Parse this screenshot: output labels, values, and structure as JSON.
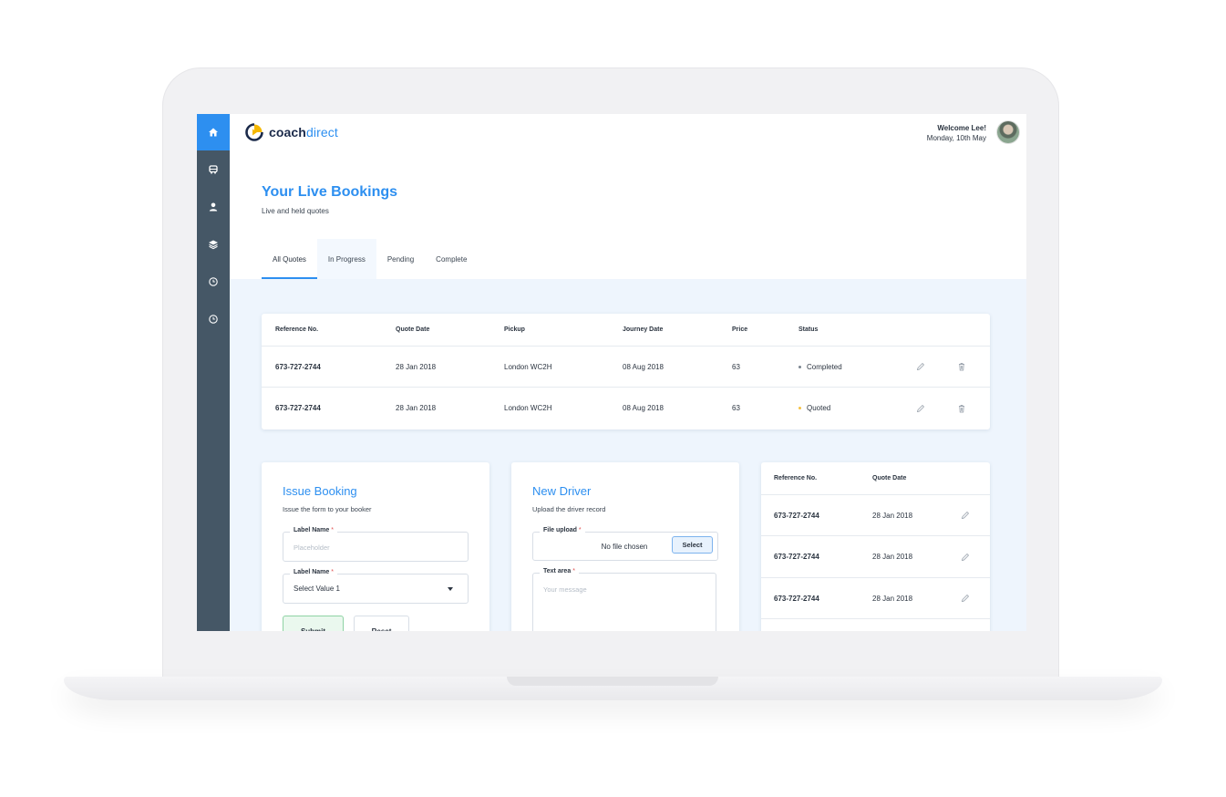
{
  "app": {
    "logo_part1": "coach",
    "logo_part2": "direct",
    "welcome": "Welcome Lee!",
    "date": "Monday, 10th May"
  },
  "sidebar": {
    "items": [
      {
        "icon": "home-icon"
      },
      {
        "icon": "bus-icon"
      },
      {
        "icon": "user-icon"
      },
      {
        "icon": "layers-icon"
      },
      {
        "icon": "clock-icon"
      },
      {
        "icon": "clock-icon"
      }
    ]
  },
  "page": {
    "title": "Your Live Bookings",
    "subtitle": "Live and held quotes"
  },
  "tabs": [
    "All Quotes",
    "In Progress",
    "Pending",
    "Complete"
  ],
  "bookings": {
    "headers": [
      "Reference No.",
      "Quote Date",
      "Pickup",
      "Journey Date",
      "Price",
      "Status"
    ],
    "rows": [
      {
        "ref": "673-727-2744",
        "quote_date": "28 Jan 2018",
        "pickup": "London WC2H",
        "journey_date": "08 Aug 2018",
        "price": "63",
        "status": "Completed",
        "status_color": "#7a8590"
      },
      {
        "ref": "673-727-2744",
        "quote_date": "28 Jan 2018",
        "pickup": "London WC2H",
        "journey_date": "08 Aug 2018",
        "price": "63",
        "status": "Quoted",
        "status_color": "#f5c242"
      }
    ]
  },
  "issue_booking": {
    "title": "Issue Booking",
    "subtitle": "Issue the form to your booker",
    "field1_label": "Label Name",
    "field1_placeholder": "Placeholder",
    "field2_label": "Label Name",
    "field2_value": "Select Value 1",
    "required_mark": "*",
    "submit": "Submit",
    "reset": "Reset"
  },
  "new_driver": {
    "title": "New Driver",
    "subtitle": "Upload the driver record",
    "upload_label": "File upload",
    "no_file": "No file chosen",
    "select": "Select",
    "textarea_label": "Text area",
    "textarea_placeholder": "Your message",
    "required_mark": "*"
  },
  "side_table": {
    "headers": [
      "Reference No.",
      "Quote Date"
    ],
    "rows": [
      {
        "ref": "673-727-2744",
        "quote_date": "28 Jan 2018"
      },
      {
        "ref": "673-727-2744",
        "quote_date": "28 Jan 2018"
      },
      {
        "ref": "673-727-2744",
        "quote_date": "28 Jan 2018"
      }
    ]
  },
  "colors": {
    "accent": "#2d8ff0",
    "sidebar": "#455766",
    "content_bg": "#eef5fd"
  }
}
